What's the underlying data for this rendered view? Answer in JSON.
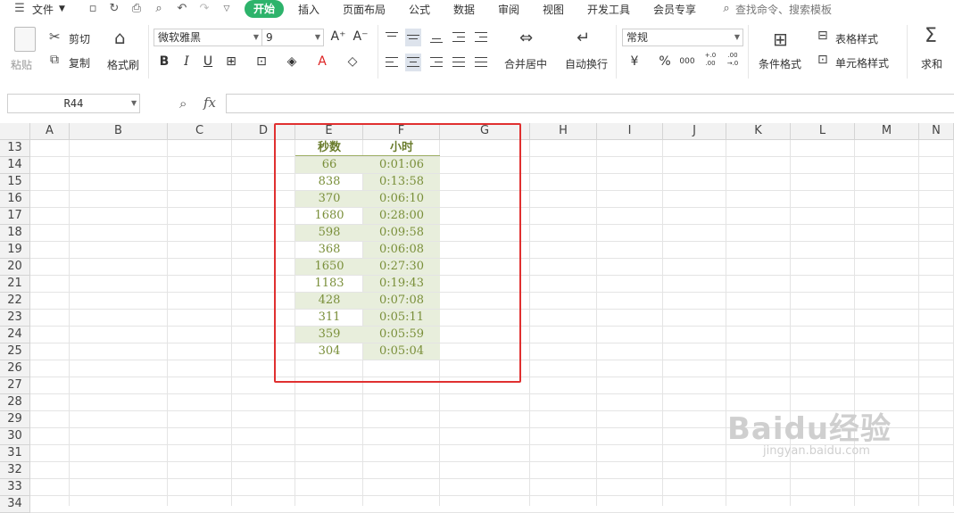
{
  "menubar": {
    "menu_icon": "hamburger-icon",
    "file_label": "文件",
    "tabs": [
      "开始",
      "插入",
      "页面布局",
      "公式",
      "数据",
      "审阅",
      "视图",
      "开发工具",
      "会员专享"
    ],
    "active_tab": "开始",
    "search_placeholder": "查找命令、搜索模板"
  },
  "ribbon": {
    "paste_label": "粘贴",
    "cut_label": "剪切",
    "copy_label": "复制",
    "format_painter_label": "格式刷",
    "font_name": "微软雅黑",
    "font_size": "9",
    "merge_center_label": "合并居中",
    "wrap_text_label": "自动换行",
    "number_format": "常规",
    "conditional_format_label": "条件格式",
    "table_style_label": "表格样式",
    "cell_style_label": "单元格样式",
    "sum_label": "求和",
    "currency_symbol": "¥",
    "percent_symbol": "%",
    "thousands_symbol": "000",
    "inc_decimal": "+.0 .00",
    "dec_decimal": ".00 →.0"
  },
  "formula_bar": {
    "name_box": "R44",
    "fx_label": "fx",
    "formula": ""
  },
  "sheet": {
    "columns": [
      "A",
      "B",
      "C",
      "D",
      "E",
      "F",
      "G",
      "H",
      "I",
      "J",
      "K",
      "L",
      "M",
      "N"
    ],
    "rows": [
      "13",
      "14",
      "15",
      "16",
      "17",
      "18",
      "19",
      "20",
      "21",
      "22",
      "23",
      "24",
      "25",
      "26",
      "27",
      "28",
      "29",
      "30",
      "31",
      "32",
      "33",
      "34"
    ],
    "header": {
      "seconds": "秒数",
      "hours": "小时"
    },
    "data": [
      {
        "seconds": "66",
        "time": "0:01:06"
      },
      {
        "seconds": "838",
        "time": "0:13:58"
      },
      {
        "seconds": "370",
        "time": "0:06:10"
      },
      {
        "seconds": "1680",
        "time": "0:28:00"
      },
      {
        "seconds": "598",
        "time": "0:09:58"
      },
      {
        "seconds": "368",
        "time": "0:06:08"
      },
      {
        "seconds": "1650",
        "time": "0:27:30"
      },
      {
        "seconds": "1183",
        "time": "0:19:43"
      },
      {
        "seconds": "428",
        "time": "0:07:08"
      },
      {
        "seconds": "311",
        "time": "0:05:11"
      },
      {
        "seconds": "359",
        "time": "0:05:59"
      },
      {
        "seconds": "304",
        "time": "0:05:04"
      }
    ],
    "highlight_color": "#e03030",
    "band_color": "#e8eedc",
    "text_color": "#7a8f3a"
  },
  "watermark": {
    "brand": "Baidu经验",
    "url": "jingyan.baidu.com"
  }
}
